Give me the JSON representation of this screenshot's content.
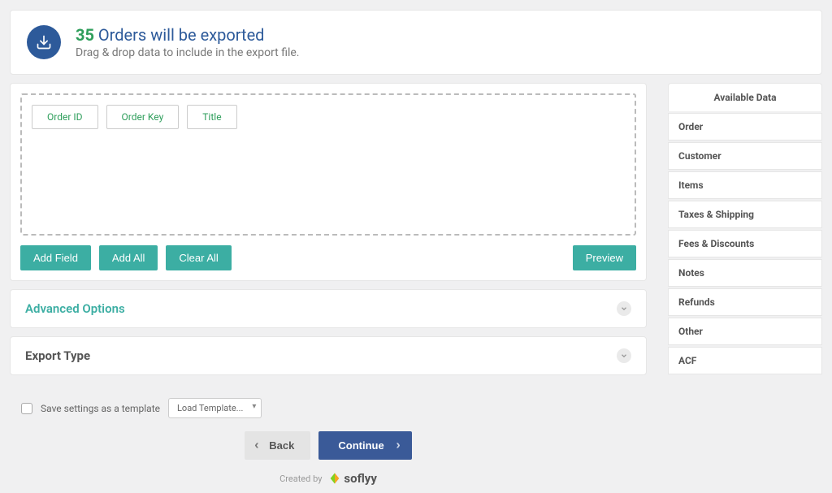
{
  "header": {
    "count": "35",
    "title_rest": "Orders will be exported",
    "subtitle": "Drag & drop data to include in the export file."
  },
  "dropzone": {
    "fields": [
      {
        "label": "Order ID"
      },
      {
        "label": "Order Key"
      },
      {
        "label": "Title"
      }
    ]
  },
  "buttons": {
    "add_field": "Add Field",
    "add_all": "Add All",
    "clear_all": "Clear All",
    "preview": "Preview"
  },
  "sections": {
    "advanced": "Advanced Options",
    "export_type": "Export Type"
  },
  "available": {
    "header": "Available Data",
    "items": [
      "Order",
      "Customer",
      "Items",
      "Taxes & Shipping",
      "Fees & Discounts",
      "Notes",
      "Refunds",
      "Other",
      "ACF"
    ]
  },
  "footer": {
    "save_label": "Save settings as a template",
    "load_template": "Load Template...",
    "back": "Back",
    "continue": "Continue",
    "created_by": "Created by",
    "brand": "soflyy"
  }
}
